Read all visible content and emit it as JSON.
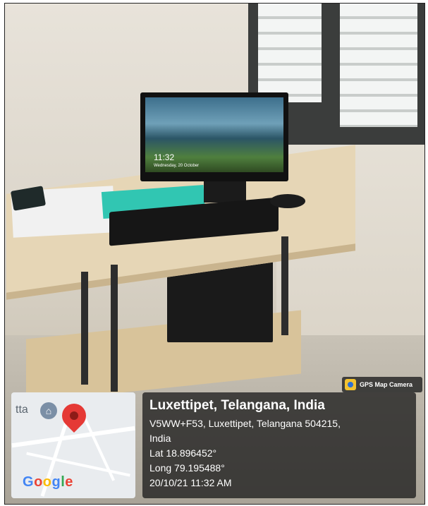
{
  "screen": {
    "time": "11:32",
    "date": "Wednesday, 20 October"
  },
  "gps_tag": {
    "label": "GPS Map Camera",
    "icon": "camera-app-icon"
  },
  "map": {
    "place_fragment": "tta",
    "brand": [
      "G",
      "o",
      "o",
      "g",
      "l",
      "e"
    ],
    "brand_colors": [
      "#4285F4",
      "#EA4335",
      "#FBBC05",
      "#4285F4",
      "#34A853",
      "#EA4335"
    ],
    "marker_icon": "location-pin-icon",
    "poi_icon": "landmark-icon"
  },
  "location": {
    "title": "Luxettipet, Telangana, India",
    "address_line1": "V5WW+F53, Luxettipet, Telangana 504215,",
    "address_line2": "India",
    "lat": "Lat 18.896452°",
    "long": "Long 79.195488°",
    "timestamp": "20/10/21 11:32 AM"
  }
}
